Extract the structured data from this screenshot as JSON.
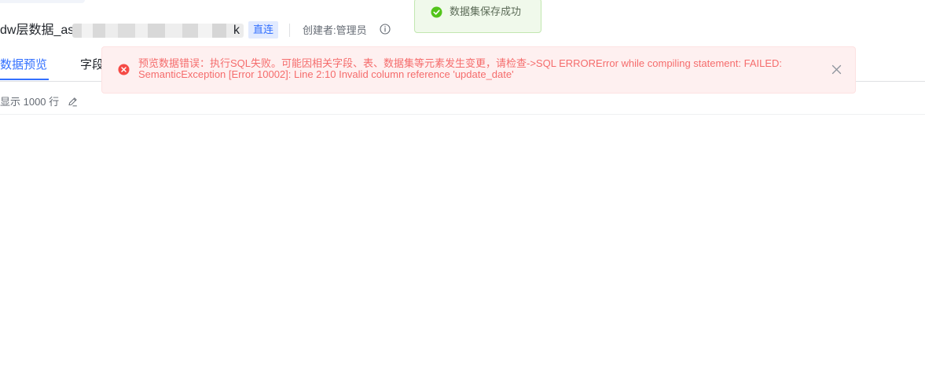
{
  "header": {
    "title_prefix": "dw层数据_as",
    "title_suffix": "k",
    "badge": "直连",
    "creator": "创建者:管理员"
  },
  "tabs": [
    {
      "label": "数据预览",
      "active": true
    },
    {
      "label": "字段"
    }
  ],
  "toolbar": {
    "rows_label": "显示 1000 行"
  },
  "toast": {
    "type": "success",
    "message": "数据集保存成功"
  },
  "error": {
    "message": "预览数据错误：执行SQL失败。可能因相关字段、表、数据集等元素发生变更，请检查->SQL ERRORError while compiling statement: FAILED: SemanticException [Error 10002]: Line 2:10 Invalid column reference 'update_date'"
  },
  "colors": {
    "accent": "#3370ff",
    "success": "#52c41a",
    "error": "#f56c6c"
  },
  "icons": {
    "info": "info-circle-icon",
    "edit": "edit-pencil-icon",
    "success": "check-circle-icon",
    "error": "close-circle-icon",
    "close": "close-icon"
  }
}
